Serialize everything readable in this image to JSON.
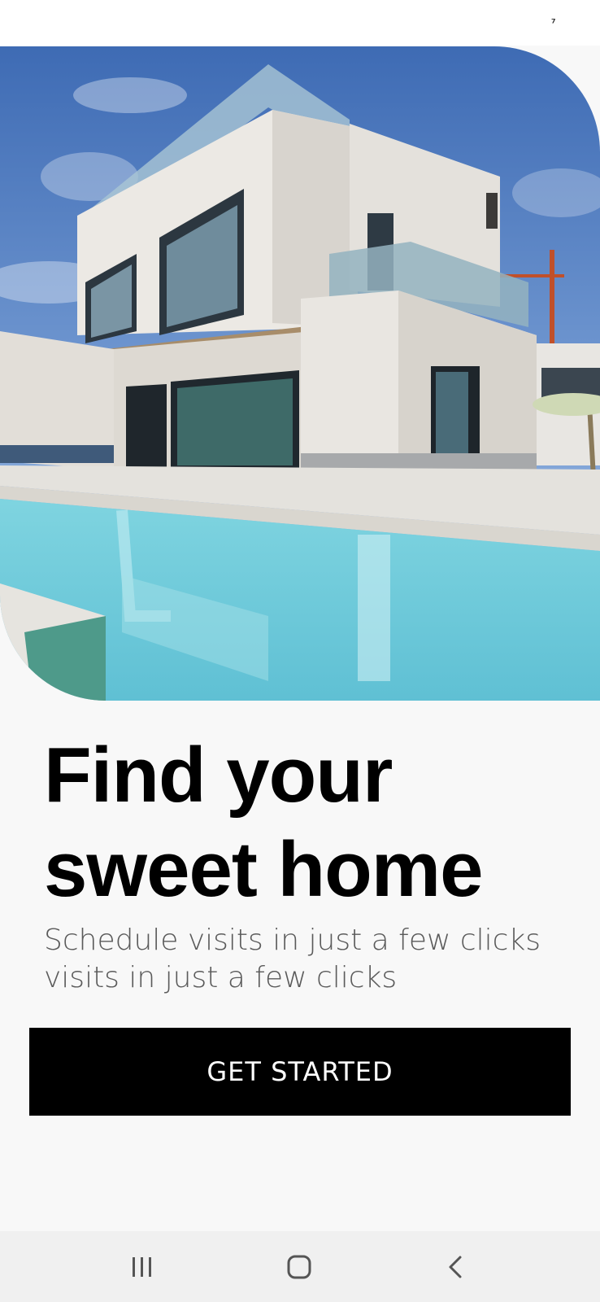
{
  "status_bar": {
    "indicator_glyph": "⁷"
  },
  "hero": {
    "image_subject": "modern-villa-with-pool"
  },
  "headline": {
    "line1": "Find your",
    "line2": "sweet home"
  },
  "subtitle": {
    "line1": "Schedule visits in just a few clicks",
    "line2": "visits in just a few clicks"
  },
  "cta": {
    "label": "GET STARTED"
  },
  "nav_bar": {
    "recents_icon": "recents-icon",
    "home_icon": "home-icon",
    "back_icon": "back-icon"
  },
  "colors": {
    "background": "#f8f8f8",
    "button": "#000000",
    "button_text": "#ffffff",
    "headline": "#000000",
    "subtitle": "#5a5a5a",
    "nav_bar": "#f0f0f0"
  }
}
